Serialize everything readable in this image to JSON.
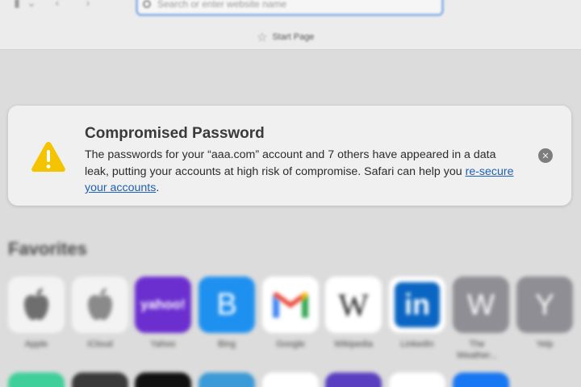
{
  "toolbar": {
    "search_placeholder": "Search or enter website name",
    "start_page_label": "Start Page"
  },
  "alert": {
    "title": "Compromised Password",
    "message_before_link": "The passwords for your “aaa.com” account and 7 others have appeared in a data leak, putting your accounts at high risk of compromise. Safari can help you ",
    "link_text": "re-secure your accounts",
    "message_after_link": "."
  },
  "favorites": {
    "heading": "Favorites",
    "items": [
      {
        "label": "Apple",
        "icon": "apple-logo-icon",
        "bg": "#f3f3f3"
      },
      {
        "label": "iCloud",
        "icon": "apple-logo-icon",
        "bg": "#f3f3f3"
      },
      {
        "label": "Yahoo",
        "icon": "yahoo-logo",
        "text": "yahoo!",
        "bg": "#6b2fd0"
      },
      {
        "label": "Bing",
        "icon": "bing-letter-icon",
        "text": "B",
        "bg": "#1e90ef"
      },
      {
        "label": "Google",
        "icon": "gmail-logo-icon",
        "bg": "#ffffff"
      },
      {
        "label": "Wikipedia",
        "icon": "wikipedia-logo-icon",
        "text": "W",
        "bg": "#ffffff"
      },
      {
        "label": "LinkedIn",
        "icon": "linkedin-logo-icon",
        "text": "in",
        "bg": "#ffffff"
      },
      {
        "label": "The Weather...",
        "icon": "letter-w-icon",
        "text": "W",
        "bg": "#8e8e94"
      },
      {
        "label": "Yelp",
        "icon": "letter-y-icon",
        "text": "Y",
        "bg": "#8e8e94"
      }
    ]
  },
  "colors": {
    "link": "#1e5fb3",
    "warning": "#f5c400",
    "url_focus_ring": "#8fb4e8"
  }
}
